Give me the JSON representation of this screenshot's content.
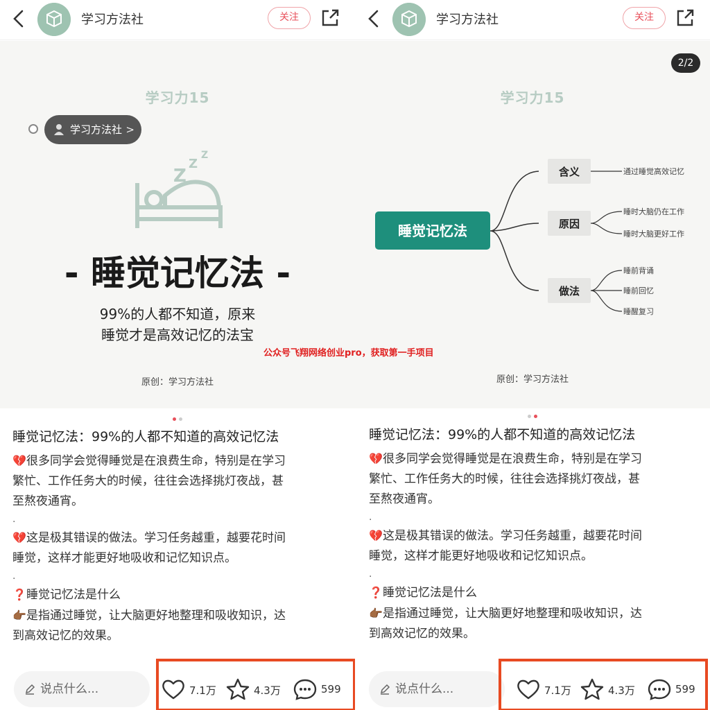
{
  "screens": [
    {
      "header": {
        "author": "学习方法社",
        "follow_label": "关注"
      },
      "card": {
        "series": "学习力15",
        "author_tag": "学习方法社",
        "title": "- 睡觉记忆法 -",
        "subtitle_lines": [
          "99%的人都不知道，原来",
          "睡觉才是高效记忆的法宝"
        ],
        "credit": "原创：学习方法社"
      },
      "pager": {
        "active_index": 0,
        "count": 2
      }
    },
    {
      "header": {
        "author": "学习方法社",
        "follow_label": "关注"
      },
      "card": {
        "page_badge": "2/2",
        "series": "学习力15",
        "credit": "原创：学习方法社",
        "mindmap": {
          "root": "睡觉记忆法",
          "branches": [
            {
              "label": "含义",
              "leaves": [
                "通过睡觉高效记忆"
              ]
            },
            {
              "label": "原因",
              "leaves": [
                "睡时大脑仍在工作",
                "睡时大脑更好工作"
              ]
            },
            {
              "label": "做法",
              "leaves": [
                "睡前背诵",
                "睡前回忆",
                "睡醒复习"
              ]
            }
          ]
        }
      },
      "pager": {
        "active_index": 1,
        "count": 2
      }
    }
  ],
  "post": {
    "title": "睡觉记忆法：99%的人都不知道的高效记忆法",
    "p1_lines": [
      "很多同学会觉得睡觉是在浪费生命，特别是在学习",
      "繁忙、工作任务大的时候，往往会选择挑灯夜战，甚",
      "至熬夜通宵。"
    ],
    "p2_lines": [
      "这是极其错误的做法。学习任务越重，越要花时间",
      "睡觉，这样才能更好地吸收和记忆知识点。"
    ],
    "p3_lines": [
      "睡觉记忆法是什么"
    ],
    "p4_lines": [
      "是指通过睡觉，让大脑更好地整理和吸收知识，达",
      "到高效记忆的效果。"
    ],
    "separator": ".",
    "emoji_broken_heart": "💔",
    "emoji_question": "❓",
    "emoji_point": "👉🏾"
  },
  "bottom": {
    "comment_placeholder": "说点什么...",
    "likes": "7.1万",
    "stars": "4.3万",
    "comments": "599"
  },
  "watermark": "公众号飞翔网络创业pro，获取第一手项目",
  "colors": {
    "accent_red": "#e8505b",
    "highlight_orange": "#e84a22",
    "mindmap_teal": "#1e8f7c",
    "bed_green": "#b7ccc3"
  }
}
